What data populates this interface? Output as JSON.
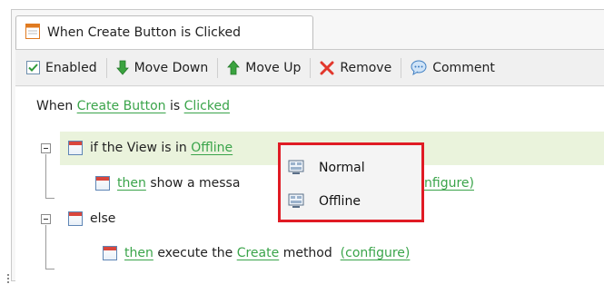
{
  "tab": {
    "title": "When Create Button is Clicked"
  },
  "toolbar": {
    "enabled_label": "Enabled",
    "move_down_label": "Move Down",
    "move_up_label": "Move Up",
    "remove_label": "Remove",
    "comment_label": "Comment"
  },
  "rule": {
    "when_prefix": "When",
    "control": "Create Button",
    "is_word": "is",
    "event": "Clicked"
  },
  "condition": {
    "prefix": "if the View is in",
    "mode": "Offline",
    "then_word": "then",
    "action_text": "show a messa",
    "configure_partial": "nfigure)"
  },
  "else_block": {
    "label": "else",
    "then_word": "then",
    "action_prefix": "execute the",
    "method": "Create",
    "action_suffix": "method",
    "configure": "(configure)"
  },
  "popup": {
    "items": [
      {
        "label": "Normal",
        "icon": "monitor-icon"
      },
      {
        "label": "Offline",
        "icon": "monitor-icon"
      }
    ],
    "highlight_color": "#e01b24"
  },
  "colors": {
    "link": "#3aa44a",
    "highlight_row": "#eaf3dc"
  }
}
